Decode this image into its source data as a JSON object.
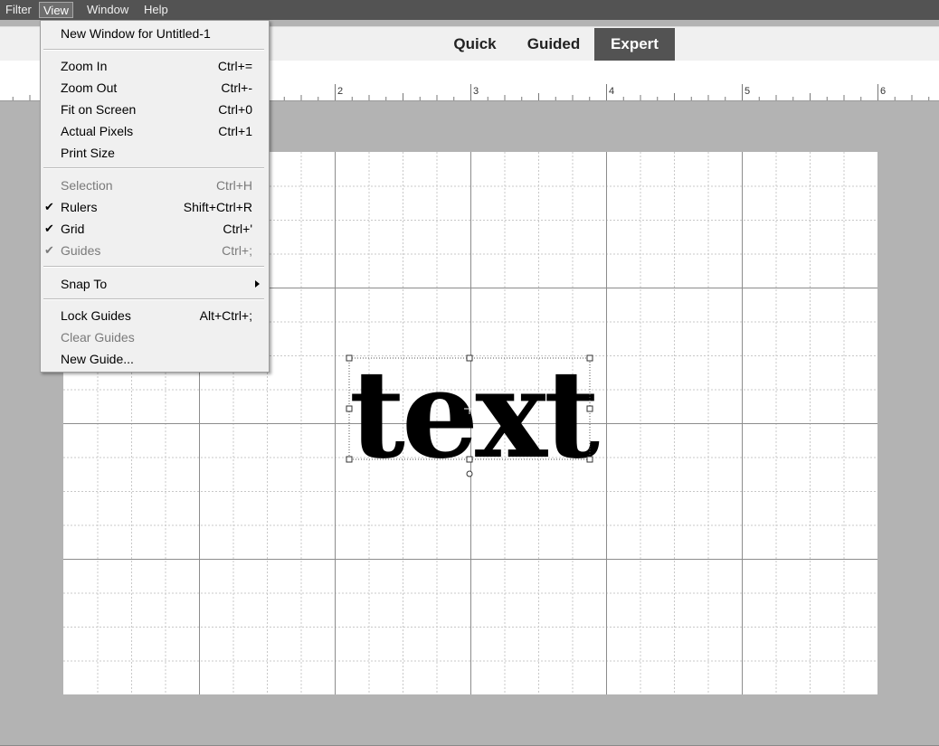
{
  "menubar": {
    "items": [
      {
        "label": "Filter"
      },
      {
        "label": "View"
      },
      {
        "label": "Window"
      },
      {
        "label": "Help"
      }
    ]
  },
  "modes": [
    {
      "label": "Quick"
    },
    {
      "label": "Guided"
    },
    {
      "label": "Expert"
    }
  ],
  "ruler": {
    "labels": [
      "2",
      "3",
      "4",
      "5",
      "6"
    ]
  },
  "canvas": {
    "text": "text"
  },
  "view_menu": {
    "items": [
      {
        "label": "New Window for Untitled-1",
        "shortcut": ""
      },
      {
        "label": "Zoom In",
        "shortcut": "Ctrl+="
      },
      {
        "label": "Zoom Out",
        "shortcut": "Ctrl+-"
      },
      {
        "label": "Fit on Screen",
        "shortcut": "Ctrl+0"
      },
      {
        "label": "Actual Pixels",
        "shortcut": "Ctrl+1"
      },
      {
        "label": "Print Size",
        "shortcut": ""
      },
      {
        "label": "Selection",
        "shortcut": "Ctrl+H",
        "disabled": true
      },
      {
        "label": "Rulers",
        "shortcut": "Shift+Ctrl+R",
        "checked": true
      },
      {
        "label": "Grid",
        "shortcut": "Ctrl+'",
        "checked": true
      },
      {
        "label": "Guides",
        "shortcut": "Ctrl+;",
        "checked": true,
        "disabled": true
      },
      {
        "label": "Snap To",
        "shortcut": "",
        "submenu": true
      },
      {
        "label": "Lock Guides",
        "shortcut": "Alt+Ctrl+;"
      },
      {
        "label": "Clear Guides",
        "shortcut": "",
        "disabled": true
      },
      {
        "label": "New Guide...",
        "shortcut": ""
      }
    ]
  },
  "colors": {
    "menubar": "#535353",
    "active_mode": "#535353",
    "workspace": "#b3b3b3",
    "grid_major": "#8c8c8c",
    "grid_minor": "#c8c8c8"
  }
}
